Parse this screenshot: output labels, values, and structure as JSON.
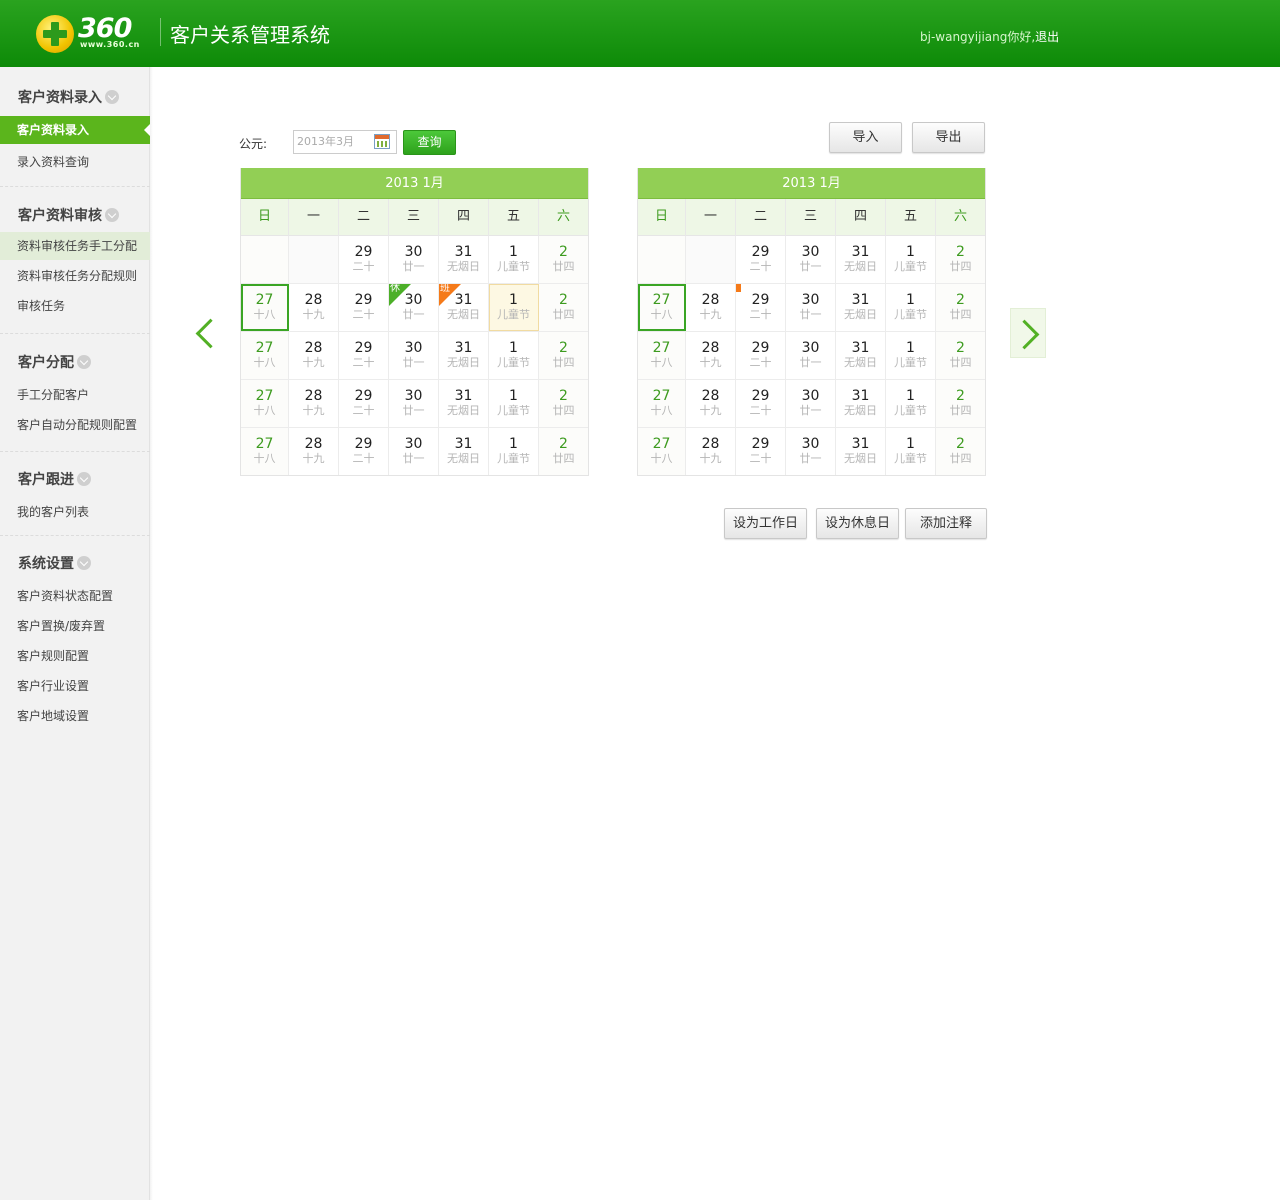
{
  "header": {
    "logo_text": "360",
    "logo_url": "www.360.cn",
    "app_title": "客户关系管理系统",
    "user_greeting": "bj-wangyijiang你好,",
    "logout_label": "退出"
  },
  "sidebar": {
    "sections": [
      {
        "title": "客户资料录入",
        "items": [
          "客户资料录入",
          "录入资料查询"
        ]
      },
      {
        "title": "客户资料审核",
        "items": [
          "资料审核任务手工分配",
          "资料审核任务分配规则",
          "审核任务"
        ]
      },
      {
        "title": "客户分配",
        "items": [
          "手工分配客户",
          "客户自动分配规则配置"
        ]
      },
      {
        "title": "客户跟进",
        "items": [
          "我的客户列表"
        ]
      },
      {
        "title": "系统设置",
        "items": [
          "客户资料状态配置",
          "客户置换/废弃置",
          "客户规则配置",
          "客户行业设置",
          "客户地域设置"
        ]
      }
    ]
  },
  "toolbar": {
    "era_label": "公元:",
    "date_placeholder": "2013年3月",
    "query_label": "查询",
    "import_label": "导入",
    "export_label": "导出"
  },
  "weekdays": [
    "日",
    "一",
    "二",
    "三",
    "四",
    "五",
    "六"
  ],
  "calendars": [
    {
      "title": "2013  1月",
      "weeks": [
        [
          null,
          null,
          {
            "n": "29",
            "l": "二十"
          },
          {
            "n": "30",
            "l": "廿一"
          },
          {
            "n": "31",
            "l": "无烟日"
          },
          {
            "n": "1",
            "l": "儿童节"
          },
          {
            "n": "2",
            "l": "廿四"
          }
        ],
        [
          {
            "n": "27",
            "l": "十八"
          },
          {
            "n": "28",
            "l": "十九"
          },
          {
            "n": "29",
            "l": "二十"
          },
          {
            "n": "30",
            "l": "廿一",
            "tag": "休"
          },
          {
            "n": "31",
            "l": "无烟日",
            "tag": "班"
          },
          {
            "n": "1",
            "l": "儿童节"
          },
          {
            "n": "2",
            "l": "廿四"
          }
        ],
        [
          {
            "n": "27",
            "l": "十八"
          },
          {
            "n": "28",
            "l": "十九"
          },
          {
            "n": "29",
            "l": "二十"
          },
          {
            "n": "30",
            "l": "廿一"
          },
          {
            "n": "31",
            "l": "无烟日"
          },
          {
            "n": "1",
            "l": "儿童节"
          },
          {
            "n": "2",
            "l": "廿四"
          }
        ],
        [
          {
            "n": "27",
            "l": "十八"
          },
          {
            "n": "28",
            "l": "十九"
          },
          {
            "n": "29",
            "l": "二十"
          },
          {
            "n": "30",
            "l": "廿一"
          },
          {
            "n": "31",
            "l": "无烟日"
          },
          {
            "n": "1",
            "l": "儿童节"
          },
          {
            "n": "2",
            "l": "廿四"
          }
        ],
        [
          {
            "n": "27",
            "l": "十八"
          },
          {
            "n": "28",
            "l": "十九"
          },
          {
            "n": "29",
            "l": "二十"
          },
          {
            "n": "30",
            "l": "廿一"
          },
          {
            "n": "31",
            "l": "无烟日"
          },
          {
            "n": "1",
            "l": "儿童节"
          },
          {
            "n": "2",
            "l": "廿四"
          }
        ]
      ]
    },
    {
      "title": "2013  1月",
      "weeks": [
        [
          null,
          null,
          {
            "n": "29",
            "l": "二十"
          },
          {
            "n": "30",
            "l": "廿一"
          },
          {
            "n": "31",
            "l": "无烟日"
          },
          {
            "n": "1",
            "l": "儿童节"
          },
          {
            "n": "2",
            "l": "廿四"
          }
        ],
        [
          {
            "n": "27",
            "l": "十八"
          },
          {
            "n": "28",
            "l": "十九"
          },
          {
            "n": "29",
            "l": "二十"
          },
          {
            "n": "30",
            "l": "廿一"
          },
          {
            "n": "31",
            "l": "无烟日"
          },
          {
            "n": "1",
            "l": "儿童节"
          },
          {
            "n": "2",
            "l": "廿四"
          }
        ],
        [
          {
            "n": "27",
            "l": "十八"
          },
          {
            "n": "28",
            "l": "十九"
          },
          {
            "n": "29",
            "l": "二十"
          },
          {
            "n": "30",
            "l": "廿一"
          },
          {
            "n": "31",
            "l": "无烟日"
          },
          {
            "n": "1",
            "l": "儿童节"
          },
          {
            "n": "2",
            "l": "廿四"
          }
        ],
        [
          {
            "n": "27",
            "l": "十八"
          },
          {
            "n": "28",
            "l": "十九"
          },
          {
            "n": "29",
            "l": "二十"
          },
          {
            "n": "30",
            "l": "廿一"
          },
          {
            "n": "31",
            "l": "无烟日"
          },
          {
            "n": "1",
            "l": "儿童节"
          },
          {
            "n": "2",
            "l": "廿四"
          }
        ],
        [
          {
            "n": "27",
            "l": "十八"
          },
          {
            "n": "28",
            "l": "十九"
          },
          {
            "n": "29",
            "l": "二十"
          },
          {
            "n": "30",
            "l": "廿一"
          },
          {
            "n": "31",
            "l": "无烟日"
          },
          {
            "n": "1",
            "l": "儿童节"
          },
          {
            "n": "2",
            "l": "廿四"
          }
        ]
      ]
    }
  ],
  "actions": {
    "set_workday_label": "设为工作日",
    "set_holiday_label": "设为休息日",
    "add_note_label": "添加注释"
  }
}
